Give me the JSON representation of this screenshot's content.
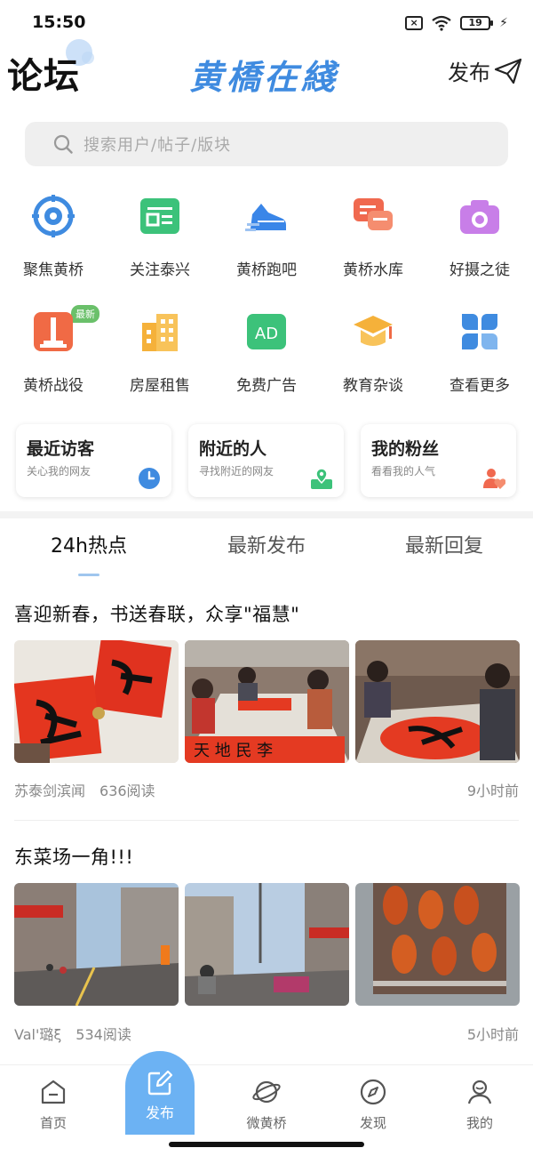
{
  "status_bar": {
    "time": "15:50",
    "battery": "19"
  },
  "header": {
    "title": "论坛",
    "logo": "黄橋在綫",
    "publish_label": "发布"
  },
  "search": {
    "placeholder": "搜索用户/帖子/版块"
  },
  "categories": [
    {
      "label": "聚焦黄桥",
      "icon": "target-icon",
      "color": "#3f8be0"
    },
    {
      "label": "关注泰兴",
      "icon": "news-icon",
      "color": "#3cc27a"
    },
    {
      "label": "黄桥跑吧",
      "icon": "sneaker-icon",
      "color": "#3a86e8"
    },
    {
      "label": "黄桥水库",
      "icon": "chat-icon",
      "color": "#f0694f"
    },
    {
      "label": "好摄之徒",
      "icon": "camera-icon",
      "color": "#c87ee8"
    },
    {
      "label": "黄桥战役",
      "icon": "monument-icon",
      "color": "#f06a45",
      "badge": "最新"
    },
    {
      "label": "房屋租售",
      "icon": "building-icon",
      "color": "#f5b13a"
    },
    {
      "label": "免费广告",
      "icon": "ad-icon",
      "color": "#3cc27a"
    },
    {
      "label": "教育杂谈",
      "icon": "graduation-cap-icon",
      "color": "#f5b13a"
    },
    {
      "label": "查看更多",
      "icon": "more-grid-icon",
      "color": "#3f8be0"
    }
  ],
  "cards": [
    {
      "title": "最近访客",
      "subtitle": "关心我的网友",
      "icon": "clock-icon"
    },
    {
      "title": "附近的人",
      "subtitle": "寻找附近的网友",
      "icon": "location-icon"
    },
    {
      "title": "我的粉丝",
      "subtitle": "看看我的人气",
      "icon": "heart-user-icon"
    }
  ],
  "tabs": [
    {
      "label": "24h热点",
      "active": true
    },
    {
      "label": "最新发布",
      "active": false
    },
    {
      "label": "最新回复",
      "active": false
    }
  ],
  "posts": [
    {
      "title": "喜迎新春，书送春联，众享\"福慧\"",
      "author": "苏泰剑滨闻",
      "reads": "636阅读",
      "time": "9小时前"
    },
    {
      "title": "东菜场一角!!!",
      "author": "Val'璐ξ",
      "reads": "534阅读",
      "time": "5小时前"
    }
  ],
  "bottom_nav": [
    {
      "label": "首页",
      "icon": "home-icon"
    },
    {
      "label": "发布",
      "icon": "edit-icon"
    },
    {
      "label": "微黄桥",
      "icon": "planet-icon"
    },
    {
      "label": "发现",
      "icon": "compass-icon"
    },
    {
      "label": "我的",
      "icon": "user-icon"
    }
  ]
}
